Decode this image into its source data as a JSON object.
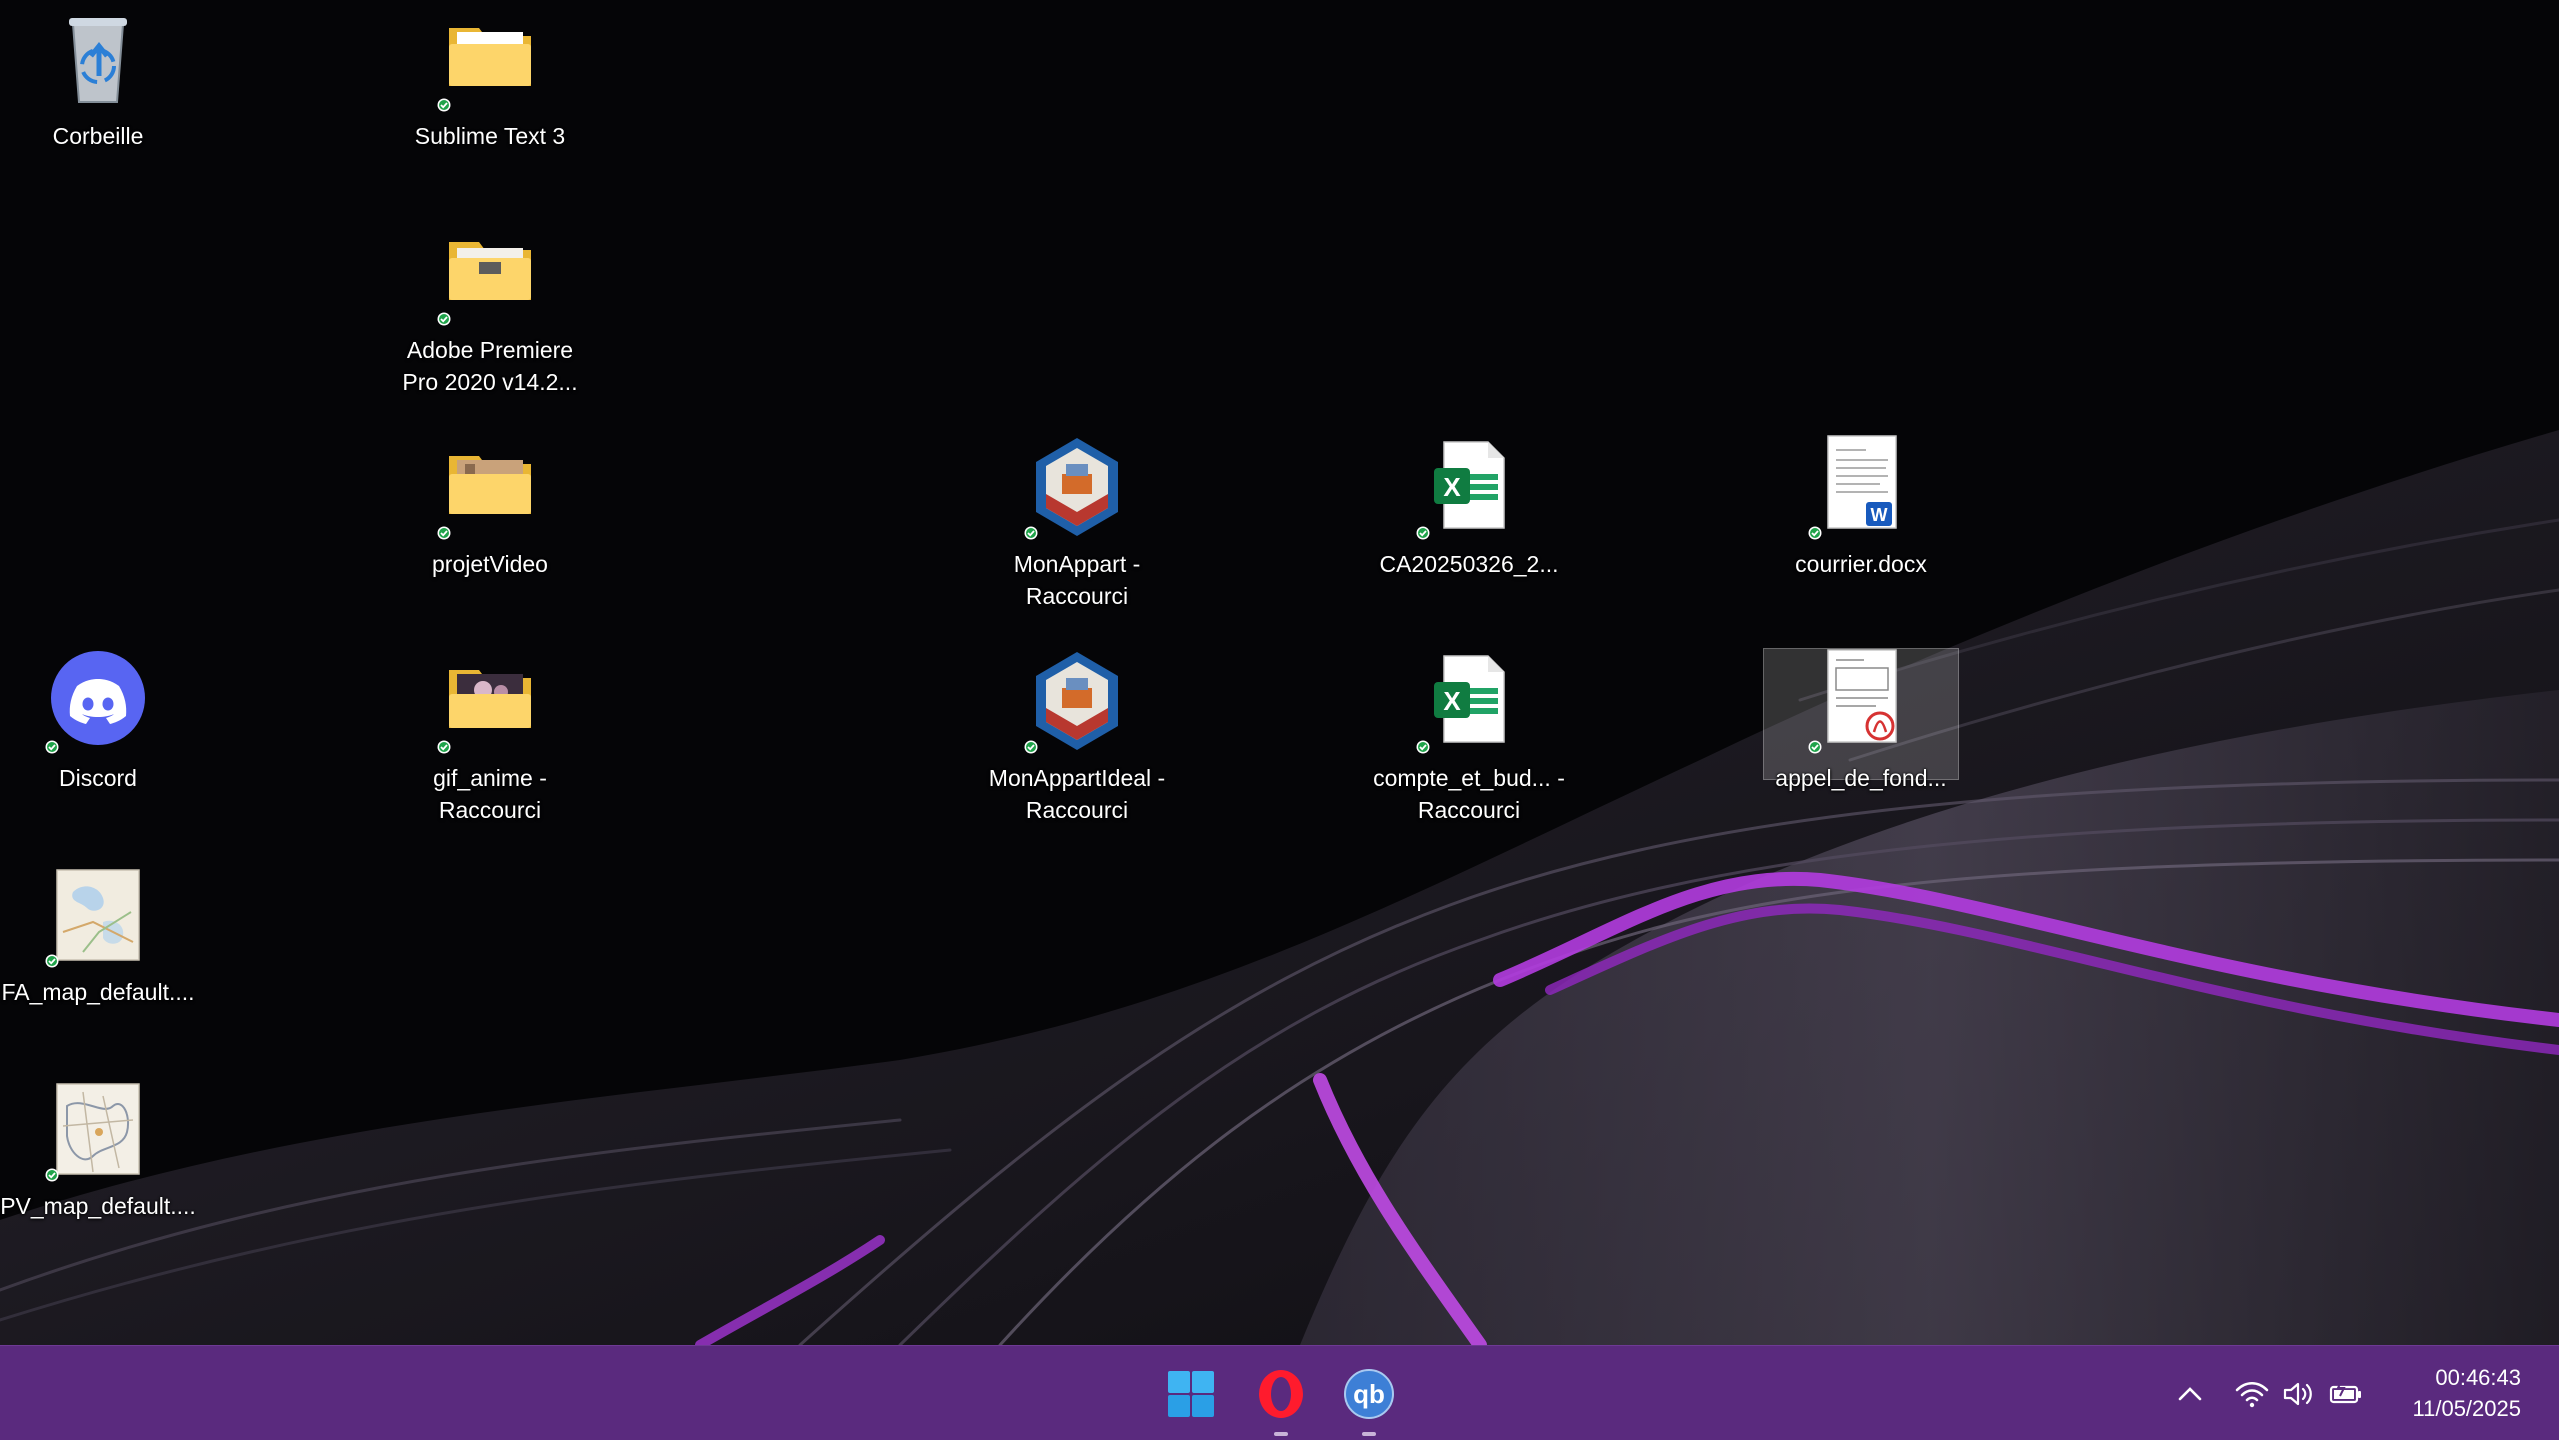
{
  "desktop": {
    "icons": [
      {
        "label": "Corbeille",
        "icon": "recycle-bin-icon"
      },
      {
        "label": "Sublime Text 3",
        "icon": "folder-icon"
      },
      {
        "label": "Adobe Premiere Pro 2020 v14.2...",
        "icon": "folder-icon"
      },
      {
        "label": "projetVideo",
        "icon": "folder-icon"
      },
      {
        "label": "MonAppart - Raccourci",
        "icon": "sweet-home-3d-icon"
      },
      {
        "label": "CA20250326_2...",
        "icon": "excel-file-icon"
      },
      {
        "label": "courrier.docx",
        "icon": "word-file-icon"
      },
      {
        "label": "Discord",
        "icon": "discord-icon"
      },
      {
        "label": "gif_anime - Raccourci",
        "icon": "folder-icon"
      },
      {
        "label": "MonAppartIdeal - Raccourci",
        "icon": "sweet-home-3d-icon"
      },
      {
        "label": "compte_et_bud... - Raccourci",
        "icon": "excel-file-icon"
      },
      {
        "label": "appel_de_fond...",
        "icon": "pdf-file-icon"
      },
      {
        "label": "FA_map_default....",
        "icon": "map-image-icon"
      },
      {
        "label": "PV_map_default....",
        "icon": "map-image-icon"
      }
    ]
  },
  "taskbar": {
    "apps": [
      {
        "name": "start",
        "icon": "windows-start-icon"
      },
      {
        "name": "opera",
        "icon": "opera-browser-icon"
      },
      {
        "name": "qbittorrent",
        "icon": "qbittorrent-icon",
        "text": "qb"
      }
    ],
    "tray": [
      "chevron-up-icon",
      "wifi-icon",
      "volume-icon",
      "battery-icon"
    ],
    "clock": {
      "time": "00:46:43",
      "date": "11/05/2025"
    }
  },
  "colors": {
    "taskbar": "#5a2a7e",
    "accent": "#b23ce0"
  }
}
